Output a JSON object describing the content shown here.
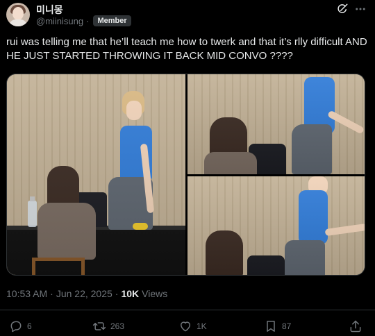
{
  "author": {
    "display_name": "미니몽",
    "handle": "@miinisung",
    "separator": "·",
    "badge": "Member"
  },
  "icons": {
    "grok": "grok-icon",
    "more": "more-icon",
    "reply": "reply-icon",
    "retweet": "retweet-icon",
    "like": "like-icon",
    "bookmark": "bookmark-icon",
    "share": "share-icon"
  },
  "tweet": {
    "text": "rui was telling me that he’ll teach me how to twerk and that it’s rlly difficult AND HE JUST STARTED THROWING IT BACK MID CONVO ????"
  },
  "meta": {
    "time": "10:53 AM",
    "sep1": "·",
    "date": "Jun 22, 2025",
    "sep2": "·",
    "views_count": "10K",
    "views_label": "Views"
  },
  "actions": {
    "replies": "6",
    "retweets": "263",
    "likes": "1K",
    "bookmarks": "87"
  },
  "colors": {
    "background": "#000000",
    "text_primary": "#e7e9ea",
    "text_secondary": "#71767b",
    "border": "#2f3336"
  }
}
